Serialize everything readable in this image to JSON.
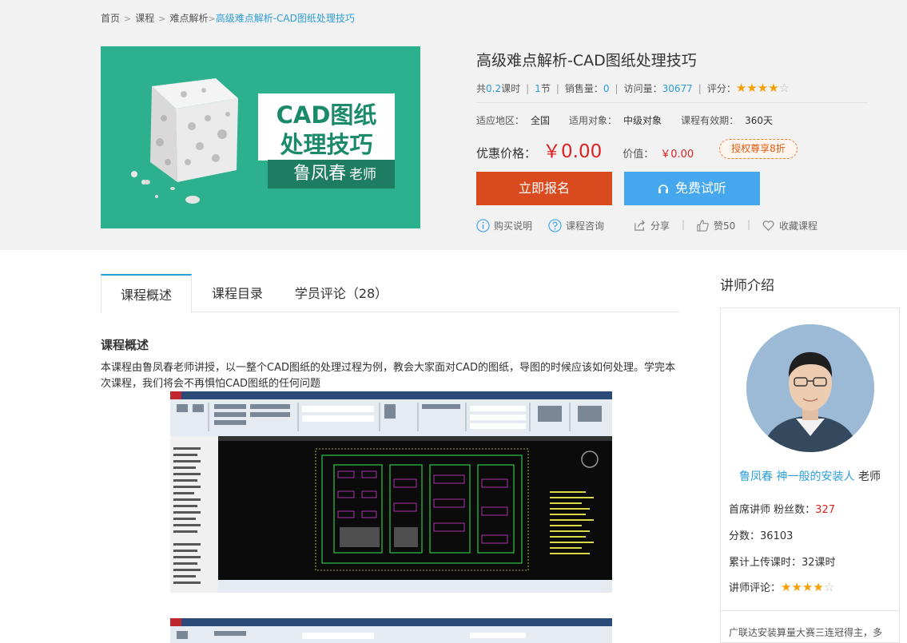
{
  "breadcrumb": {
    "items": [
      "首页",
      "课程",
      "难点解析"
    ],
    "current": "高级难点解析-CAD图纸处理技巧"
  },
  "cover": {
    "line1": "CAD图纸",
    "line2": "处理技巧",
    "teacher": "鲁凤春",
    "teacher_suffix": "老师"
  },
  "course": {
    "title": "高级难点解析-CAD图纸处理技巧",
    "hours_prefix": "共",
    "hours_value": "0.2",
    "hours_unit": "课时",
    "sections_value": "1",
    "sections_unit": "节",
    "sales_label": "销售量：",
    "sales_value": "0",
    "views_label": "访问量：",
    "views_value": "30677",
    "rating_label": "评分：",
    "rating": 4,
    "rating_max": 5,
    "region_label": "适应地区：",
    "region": "全国",
    "audience_label": "适用对象：",
    "audience": "中级对象",
    "validity_label": "课程有效期：",
    "validity": "360天",
    "price_label": "优惠价格：",
    "price": "￥0.00",
    "orig_label": "价值：",
    "orig_price": "￥0.00",
    "promo": "授权尊享8折"
  },
  "buttons": {
    "enroll": "立即报名",
    "trial": "免费试听"
  },
  "actions": {
    "buy_info": "购买说明",
    "consult": "课程咨询",
    "share": "分享",
    "like": "赞50",
    "favorite": "收藏课程"
  },
  "tabs": [
    "课程概述",
    "课程目录",
    "学员评论（28）"
  ],
  "overview": {
    "heading": "课程概述",
    "text": " 本课程由鲁凤春老师讲授，以一整个CAD图纸的处理过程为例，教会大家面对CAD的图纸，导图的时候应该如何处理。学完本次课程，我们将会不再惧怕CAD图纸的任何问题"
  },
  "teacher": {
    "section_title": "讲师介绍",
    "name": "鲁凤春 神一般的安装人",
    "suffix": "老师",
    "title_label": "首席讲师",
    "fans_label": "粉丝数：",
    "fans": "327",
    "score_label": "分数：",
    "score": "36103",
    "uploads_label": "累计上传课时：",
    "uploads": "32课时",
    "review_label": "讲师评论：",
    "review_rating": 4,
    "intro": "广联达安装算量大赛三连冠得主，多"
  },
  "colors": {
    "accent": "#2d9ed8",
    "enroll": "#d94a1e",
    "trial": "#45a8ee",
    "price": "#dd2222",
    "star": "#f5a000",
    "cover_bg": "#2db08d"
  }
}
